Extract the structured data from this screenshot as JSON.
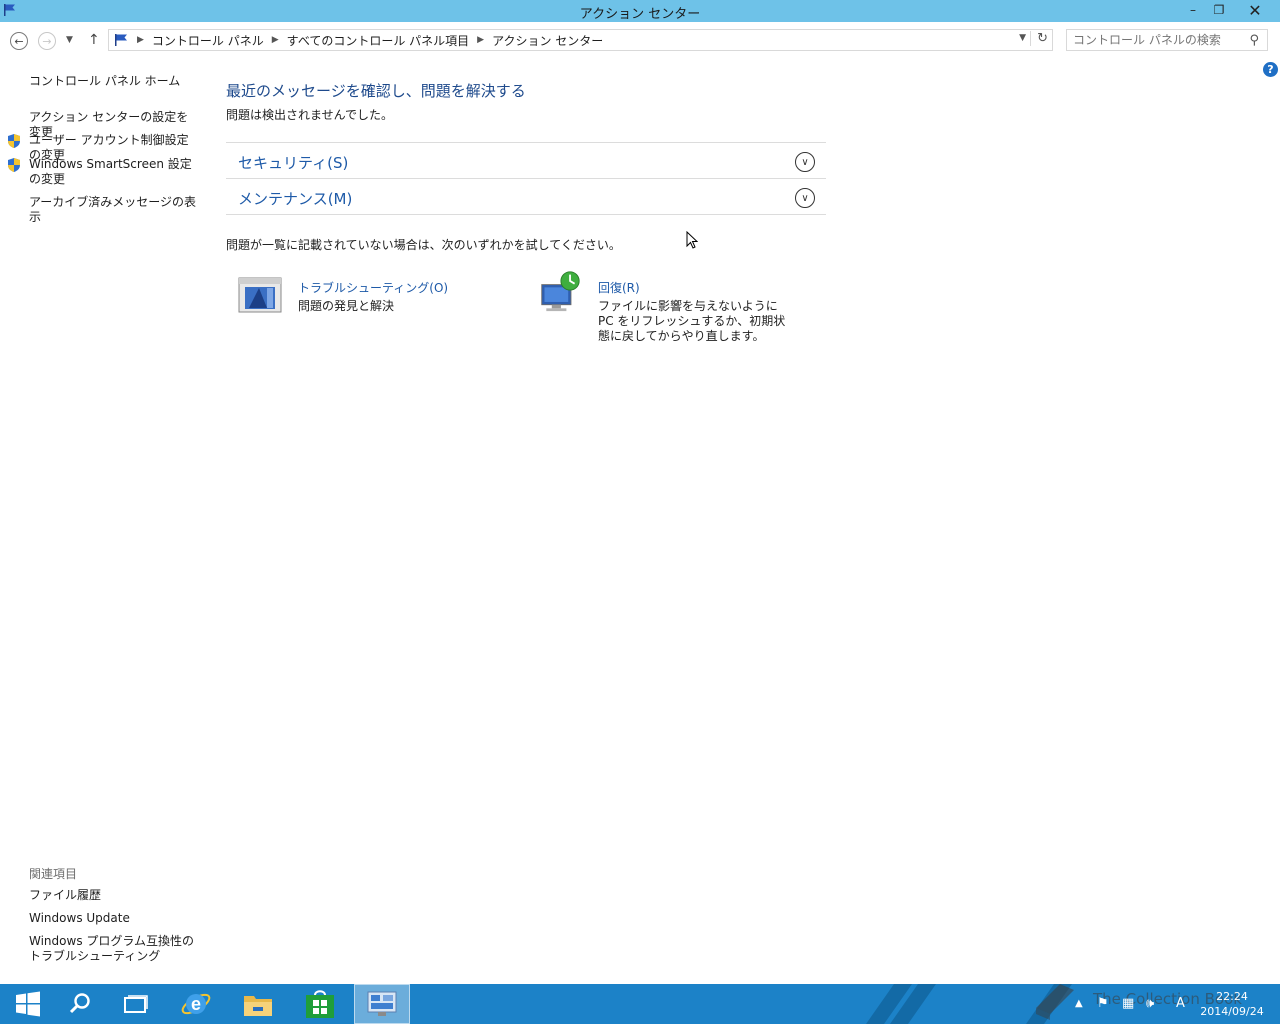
{
  "window": {
    "title": "アクション センター",
    "controls": {
      "minimize": "–",
      "maximize": "❐",
      "close": "✕"
    }
  },
  "navigation": {
    "back_icon": "arrow-left-icon",
    "forward_icon": "arrow-right-icon",
    "up_icon": "arrow-up-icon",
    "breadcrumb": [
      "コントロール パネル",
      "すべてのコントロール パネル項目",
      "アクション センター"
    ],
    "search_placeholder": "コントロール パネルの検索"
  },
  "help_label": "?",
  "sidebar": {
    "home": "コントロール パネル ホーム",
    "items": [
      {
        "label": "アクション センターの設定を変更",
        "shield": false
      },
      {
        "label": "ユーザー アカウント制御設定の変更",
        "shield": true
      },
      {
        "label": "Windows SmartScreen 設定の変更",
        "shield": true
      },
      {
        "label": "アーカイブ済みメッセージの表示",
        "shield": false
      }
    ],
    "related_title": "関連項目",
    "related": [
      "ファイル履歴",
      "Windows Update",
      "Windows プログラム互換性のトラブルシューティング"
    ]
  },
  "main": {
    "title": "最近のメッセージを確認し、問題を解決する",
    "subtitle": "問題は検出されませんでした。",
    "sections": [
      {
        "label": "セキュリティ(S)"
      },
      {
        "label": "メンテナンス(M)"
      }
    ],
    "hint": "問題が一覧に記載されていない場合は、次のいずれかを試してください。",
    "tools": [
      {
        "link": "トラブルシューティング(O)",
        "desc": "問題の発見と解決",
        "icon": "troubleshooting-icon"
      },
      {
        "link": "回復(R)",
        "desc": "ファイルに影響を与えないように PC をリフレッシュするか、初期状態に戻してからやり直します。",
        "icon": "recovery-icon"
      }
    ]
  },
  "taskbar": {
    "apps": [
      "start-icon",
      "search-icon",
      "task-view-icon",
      "internet-explorer-icon",
      "file-explorer-icon",
      "store-icon",
      "control-panel-icon"
    ],
    "time": "22:24",
    "date": "2014/09/24",
    "ime": "A",
    "watermark": "The Collection Book"
  },
  "colors": {
    "titlebar": "#6ec2e8",
    "taskbar": "#1c82c8",
    "link": "#1e5aa8",
    "heading": "#1e4a8c"
  }
}
